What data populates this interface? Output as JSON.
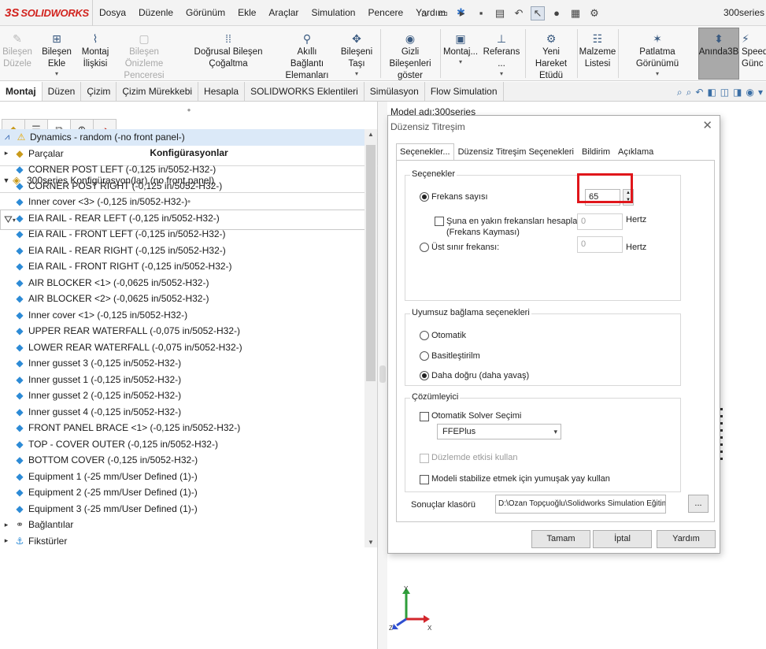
{
  "app": {
    "logo_text": "SOLIDWORKS",
    "doc_title": "300series"
  },
  "menu": [
    "Dosya",
    "Düzenle",
    "Görünüm",
    "Ekle",
    "Araçlar",
    "Simulation",
    "Pencere",
    "Yardım"
  ],
  "ribbon": {
    "bilesen_duzenle": [
      "Bileşen",
      "Düzele"
    ],
    "bilesen_ekle": "Bileşen Ekle",
    "montaj_iliskisi": [
      "Montaj",
      "İlişkisi"
    ],
    "bilesen_onizleme": [
      "Bileşen Önizleme",
      "Penceresi"
    ],
    "dogrusal": "Doğrusal Bileşen Çoğaltma",
    "akilli_baglanti": [
      "Akıllı Bağlantı",
      "Elemanları"
    ],
    "bileseni_tasi": "Bileşeni Taşı",
    "gizli_bilesenler": [
      "Gizli Bileşenleri",
      "göster"
    ],
    "montaj_dd": "Montaj...",
    "referans_dd": "Referans ...",
    "yeni_hareket": [
      "Yeni Hareket",
      "Etüdü"
    ],
    "malzeme": [
      "Malzeme",
      "Listesi"
    ],
    "patlatma": "Patlatma Görünümü",
    "anlik": "Anında3B",
    "speed": [
      "Speed",
      "Günc"
    ]
  },
  "cm_tabs": [
    "Montaj",
    "Düzen",
    "Çizim",
    "Çizim Mürekkebi",
    "Hesapla",
    "SOLIDWORKS Eklentileri",
    "Simülasyon",
    "Flow Simulation"
  ],
  "left_panel": {
    "section_title": "Konfigürasyonlar",
    "config_selector": "300series Konfigürasyon(lar)  (no front panel)",
    "tree": {
      "root": "Dynamics - random (-no front panel-)",
      "parts_label": "Parçalar",
      "parts": [
        "CORNER POST LEFT (-0,125 in/5052-H32-)",
        "CORNER POST RIGHT (-0,125 in/5052-H32-)",
        "Inner cover <3> (-0,125 in/5052-H32-)",
        "EIA RAIL - REAR LEFT (-0,125 in/5052-H32-)",
        "EIA RAIL - FRONT LEFT (-0,125 in/5052-H32-)",
        "EIA RAIL - REAR RIGHT (-0,125 in/5052-H32-)",
        "EIA RAIL - FRONT RIGHT (-0,125 in/5052-H32-)",
        "AIR BLOCKER <1> (-0,0625 in/5052-H32-)",
        "AIR BLOCKER <2> (-0,0625 in/5052-H32-)",
        "Inner cover <1> (-0,125 in/5052-H32-)",
        "UPPER REAR WATERFALL (-0,075 in/5052-H32-)",
        "LOWER REAR WATERFALL (-0,075 in/5052-H32-)",
        "Inner gusset 3 (-0,125 in/5052-H32-)",
        "Inner gusset 1 (-0,125 in/5052-H32-)",
        "Inner gusset 2 (-0,125 in/5052-H32-)",
        "Inner gusset 4 (-0,125 in/5052-H32-)",
        "FRONT PANEL BRACE <1> (-0,125 in/5052-H32-)",
        "TOP - COVER OUTER (-0,125 in/5052-H32-)",
        "BOTTOM COVER (-0,125 in/5052-H32-)",
        "Equipment 1 (-25 mm/User Defined (1)-)",
        "Equipment 2 (-25 mm/User Defined (1)-)",
        "Equipment 3 (-25 mm/User Defined (1)-)"
      ],
      "connections_label": "Bağlantılar",
      "fixtures_label": "Fikstürler"
    }
  },
  "graphics": {
    "model_name": "Model adı:300series",
    "axes": {
      "x": "X",
      "y": "Y",
      "z": "Z"
    }
  },
  "dialog": {
    "title": "Düzensiz Titreşim",
    "tabs": [
      "Seçenekler...",
      "Düzensiz Titreşim Seçenekleri",
      "Bildirim",
      "Açıklama"
    ],
    "options_group": "Seçenekler",
    "freq_count_label": "Frekans sayısı",
    "freq_count_value": "65",
    "nearest_label": [
      "Şuna en yakın frekansları hesapla:",
      "(Frekans Kayması)"
    ],
    "nearest_value": "0",
    "unit_hz": "Hertz",
    "upper_label": "Üst sınır frekansı:",
    "upper_value": "0",
    "incompat_group": "Uyumsuz bağlama seçenekleri",
    "radio_auto": "Otomatik",
    "radio_simple": "Basitleştirilm",
    "radio_accurate": "Daha doğru (daha yavaş)",
    "solver_group": "Çözümleyici",
    "auto_solver": "Otomatik Solver Seçimi",
    "solver_value": "FFEPlus",
    "inplane": "Düzlemde etkisi kullan",
    "stabilize": "Modeli stabilize etmek için yumuşak yay kullan",
    "results_label": "Sonuçlar klasörü",
    "results_path": "D:\\Ozan Topçuoğlu\\Solidworks Simulation Eğitim",
    "browse": "...",
    "ok": "Tamam",
    "cancel": "İptal",
    "help": "Yardım"
  },
  "colors": {
    "brand_red": "#d2231e",
    "highlight_red": "#e0161b",
    "tree_selection": "#dbe9f8"
  },
  "icons": [
    "solidworks-logo-icon",
    "pin-icon",
    "home-icon",
    "new-file-icon",
    "open-icon",
    "save-icon",
    "print-icon",
    "undo-icon",
    "select-icon",
    "traffic-light-icon",
    "file-props-icon",
    "gear-icon",
    "warning-icon",
    "part-icon",
    "shell-icon",
    "filter-icon"
  ]
}
